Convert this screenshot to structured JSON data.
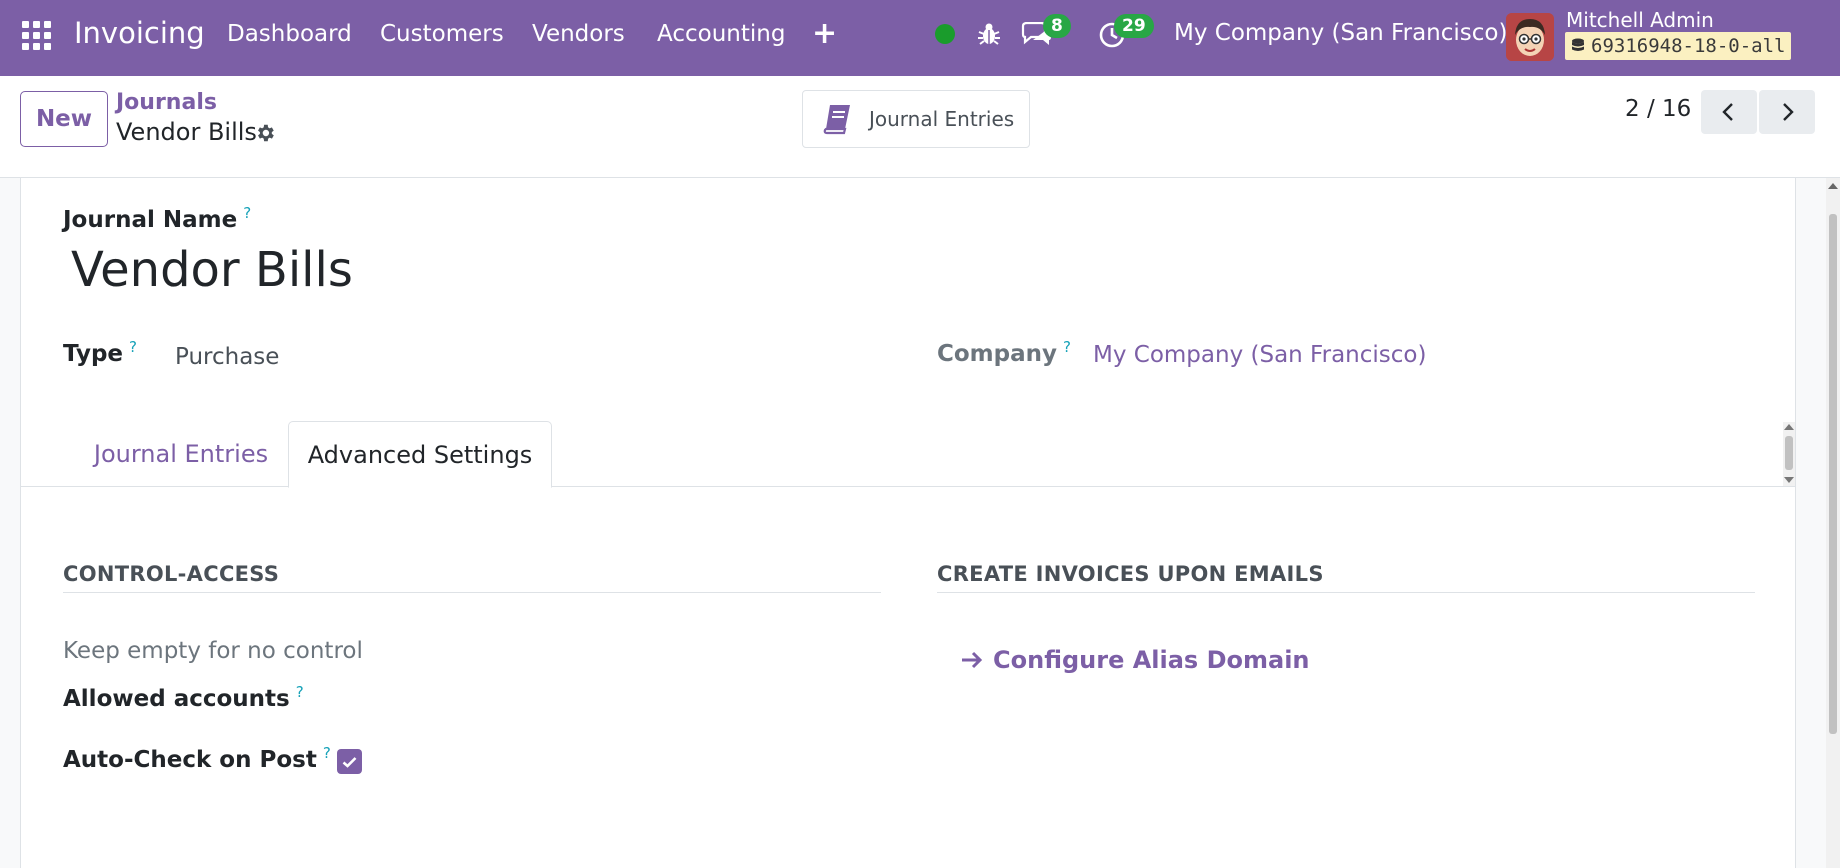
{
  "topbar": {
    "app_name": "Invoicing",
    "menus": [
      "Dashboard",
      "Customers",
      "Vendors",
      "Accounting"
    ],
    "plus_label": "+",
    "messages_count": "8",
    "activities_count": "29",
    "company": "My Company (San Francisco)",
    "user_name": "Mitchell Admin",
    "database": "69316948-18-0-all",
    "colors": {
      "brand": "#7c5fa6",
      "badge": "#28a745",
      "status_online": "#1a9c2c"
    }
  },
  "control_panel": {
    "new_label": "New",
    "breadcrumb_parent": "Journals",
    "breadcrumb_current": "Vendor Bills",
    "smart_button_label": "Journal Entries",
    "pager": "2 / 16"
  },
  "form": {
    "name_label": "Journal Name",
    "name_value": "Vendor Bills",
    "type_label": "Type",
    "type_value": "Purchase",
    "company_label": "Company",
    "company_value": "My Company (San Francisco)",
    "help_mark": "?",
    "tabs": [
      {
        "label": "Journal Entries",
        "active": false
      },
      {
        "label": "Advanced Settings",
        "active": true
      }
    ],
    "control_access": {
      "heading": "CONTROL-ACCESS",
      "help_text": "Keep empty for no control",
      "allowed_accounts_label": "Allowed accounts",
      "auto_check_label": "Auto-Check on Post",
      "auto_check_value": true
    },
    "emails": {
      "heading": "CREATE INVOICES UPON EMAILS",
      "configure_link": "Configure Alias Domain"
    }
  }
}
